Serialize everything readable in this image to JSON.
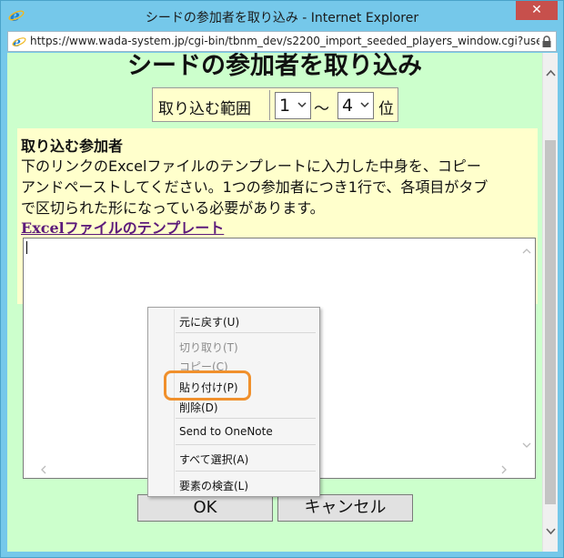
{
  "window": {
    "title": "シードの参加者を取り込み - Internet Explorer",
    "close_label": "✕",
    "url": "https://www.wada-system.jp/cgi-bin/tbnm_dev/s2200_import_seeded_players_window.cgi?use"
  },
  "page": {
    "title": "シードの参加者を取り込み",
    "range": {
      "label": "取り込む範囲",
      "from_value": "1",
      "separator": "〜",
      "to_value": "4",
      "suffix": "位"
    },
    "instructions": {
      "heading": "取り込む参加者",
      "lines": [
        "下のリンクのExcelファイルのテンプレートに入力した中身を、コピー",
        "アンドペーストしてください。1つの参加者につき1行で、各項目がタブ",
        "で区切られた形になっている必要があります。"
      ],
      "link_text": "Excelファイルのテンプレート"
    },
    "buttons": {
      "ok": "OK",
      "cancel": "キャンセル"
    }
  },
  "context_menu": {
    "items": [
      {
        "label": "元に戻す(U)",
        "disabled": false
      },
      {
        "label": "切り取り(T)",
        "disabled": true
      },
      {
        "label": "コピー(C)",
        "disabled": true
      },
      {
        "label": "貼り付け(P)",
        "disabled": false,
        "highlighted": true
      },
      {
        "label": "削除(D)",
        "disabled": false
      },
      {
        "label": "Send to OneNote",
        "disabled": false
      },
      {
        "label": "すべて選択(A)",
        "disabled": false
      },
      {
        "label": "要素の検査(L)",
        "disabled": false
      }
    ]
  },
  "colors": {
    "page_background": "#ccffcc",
    "panel_background": "#ffffcc",
    "highlight_ring": "#f0902c",
    "link": "#5c1a7a"
  }
}
